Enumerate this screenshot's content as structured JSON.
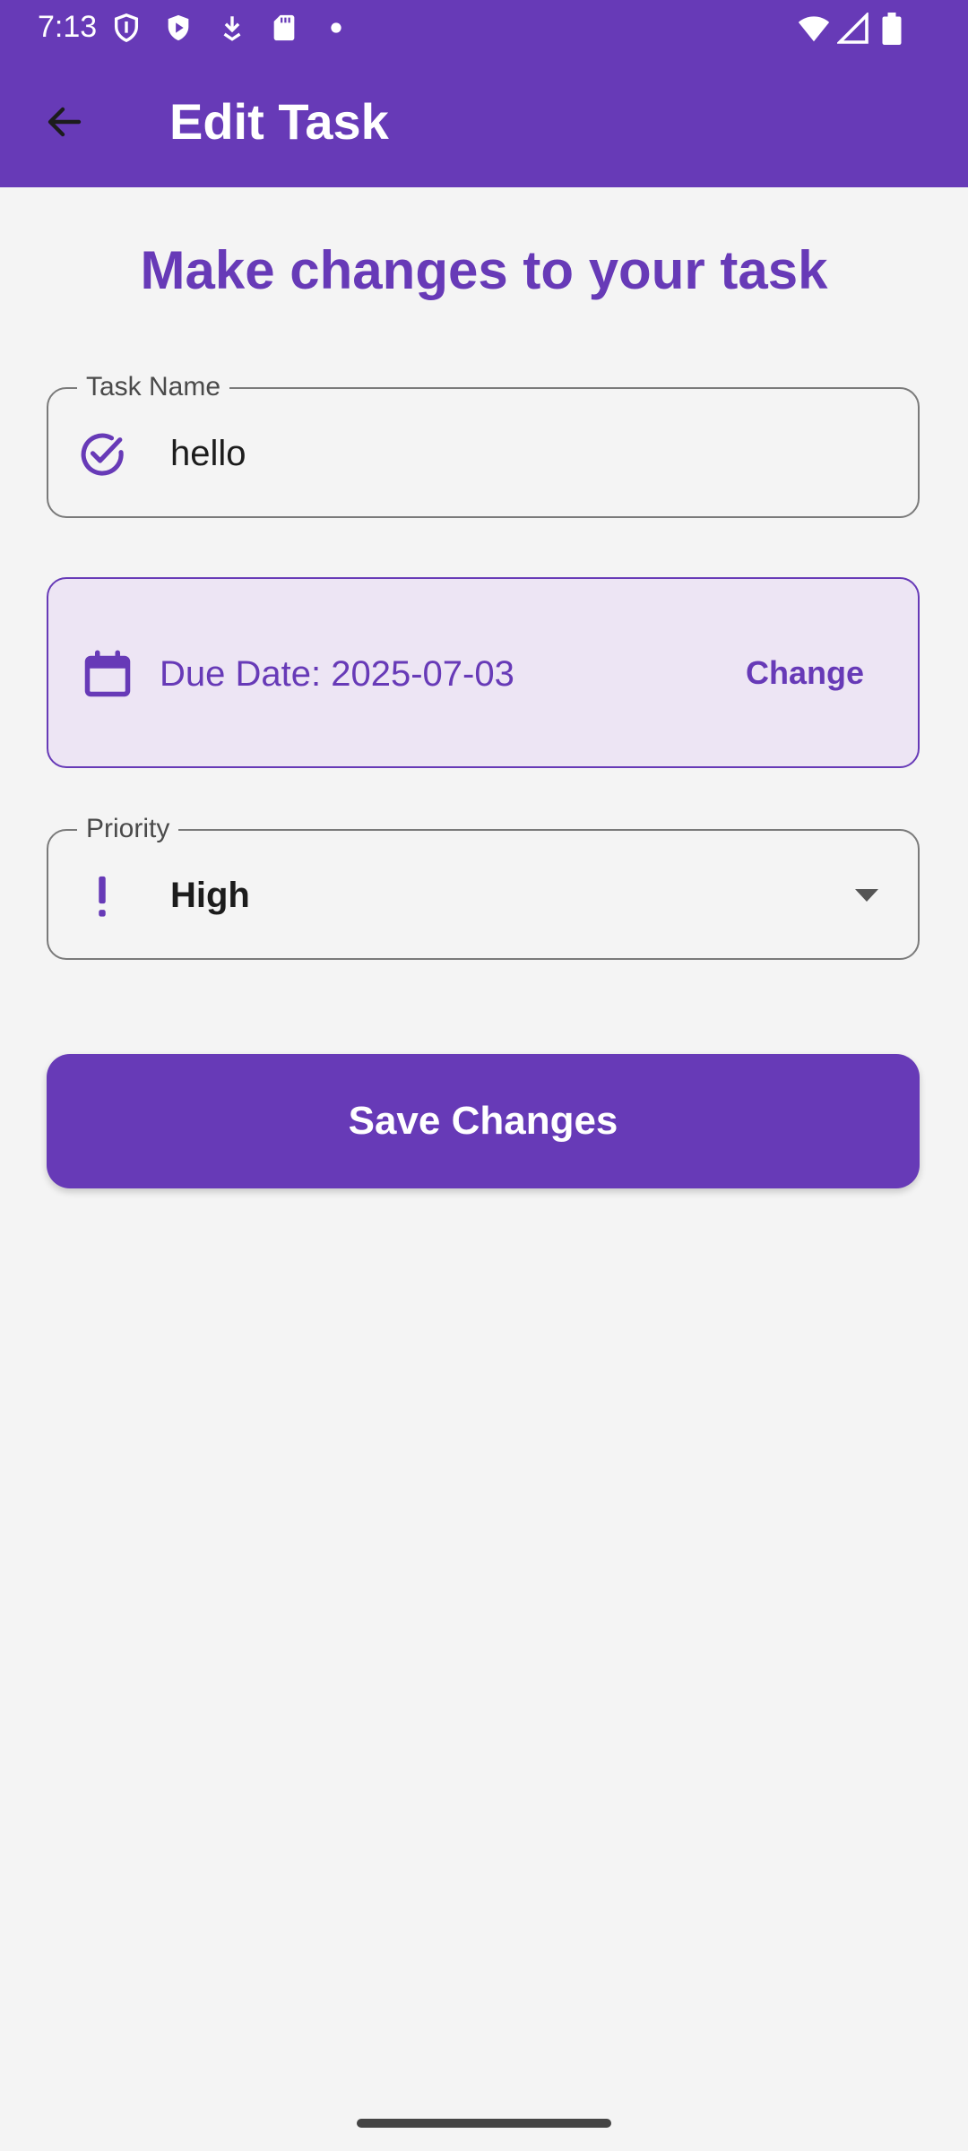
{
  "status_bar": {
    "time": "7:13",
    "left_icons": [
      "shield-icon",
      "play-protect-icon",
      "download-icon",
      "sd-card-icon",
      "dot-icon"
    ],
    "right_icons": [
      "wifi-icon",
      "signal-icon",
      "battery-icon"
    ]
  },
  "toolbar": {
    "back_icon": "arrow-back-icon",
    "title": "Edit Task"
  },
  "page": {
    "heading": "Make changes to your task"
  },
  "task_name": {
    "label": "Task Name",
    "value": "hello",
    "icon": "check-circle-icon"
  },
  "due_date": {
    "text": "Due Date: 2025-07-03",
    "change_label": "Change",
    "icon": "calendar-icon"
  },
  "priority": {
    "label": "Priority",
    "value": "High",
    "icon": "exclamation-icon",
    "dropdown_icon": "arrow-drop-down-icon"
  },
  "actions": {
    "save_label": "Save Changes"
  },
  "colors": {
    "primary": "#673ab7",
    "background": "#f4f4f4",
    "date_card_background": "#ede5f4",
    "outline": "#7a7a7a"
  }
}
